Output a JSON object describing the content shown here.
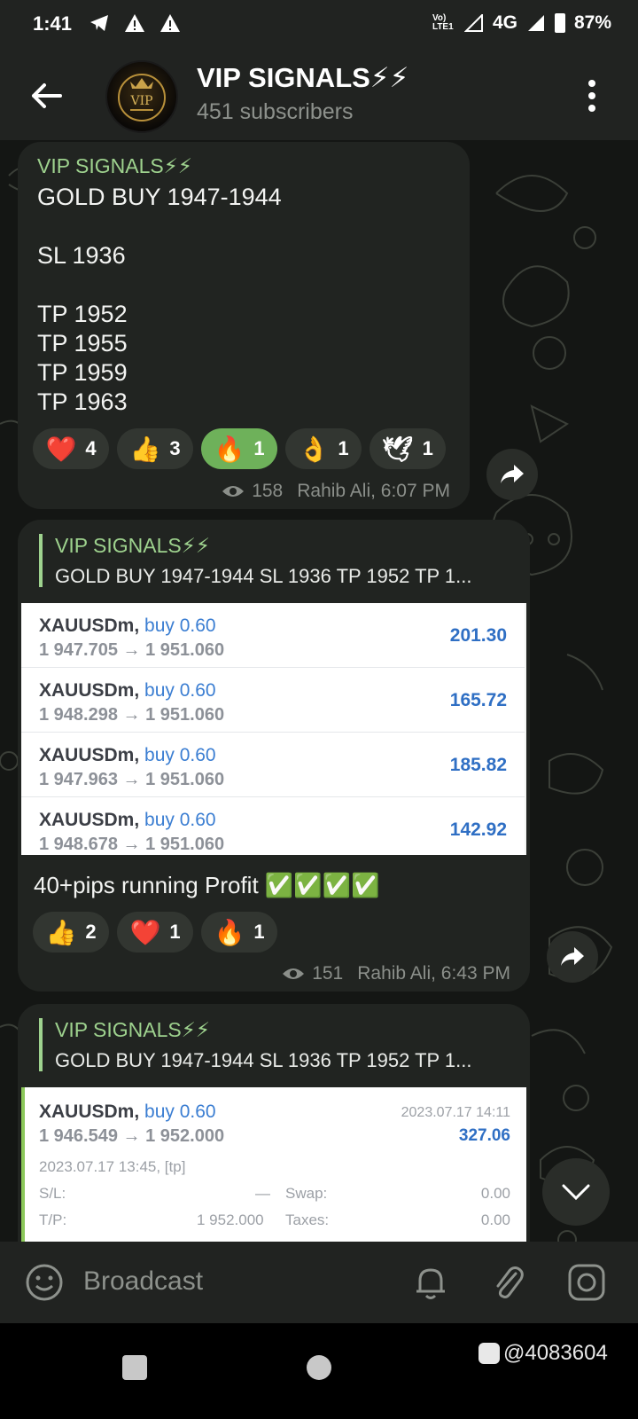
{
  "status_bar": {
    "time": "1:41",
    "left_icons": [
      "telegram-icon",
      "warning-icon",
      "warning-icon"
    ],
    "network": "4G",
    "volte": "Vo) LTE1",
    "battery": "87%"
  },
  "header": {
    "title": "VIP SIGNALS⚡⚡",
    "subtitle": "451 subscribers",
    "avatar_text": "VIP"
  },
  "messages": [
    {
      "sender": "VIP SIGNALS⚡⚡",
      "text": "GOLD BUY 1947-1944\n\nSL 1936\n\nTP 1952\nTP 1955\nTP 1959\nTP 1963",
      "reactions": [
        {
          "emoji": "❤️",
          "count": "4",
          "active": false
        },
        {
          "emoji": "👍",
          "count": "3",
          "active": false
        },
        {
          "emoji": "🔥",
          "count": "1",
          "active": true
        },
        {
          "emoji": "👌",
          "count": "1",
          "active": false
        },
        {
          "emoji": "🕊",
          "count": "1",
          "active": false
        }
      ],
      "views": "158",
      "author_time": "Rahib Ali, 6:07 PM"
    },
    {
      "reply_name": "VIP SIGNALS⚡⚡",
      "reply_text": "GOLD BUY 1947-1944  SL 1936  TP 1952 TP 1...",
      "trades": [
        {
          "symbol": "XAUUSDm,",
          "side": "buy 0.60",
          "prices": "1 947.705 → 1 951.060",
          "profit": "201.30"
        },
        {
          "symbol": "XAUUSDm,",
          "side": "buy 0.60",
          "prices": "1 948.298 → 1 951.060",
          "profit": "165.72"
        },
        {
          "symbol": "XAUUSDm,",
          "side": "buy 0.60",
          "prices": "1 947.963 → 1 951.060",
          "profit": "185.82"
        },
        {
          "symbol": "XAUUSDm,",
          "side": "buy 0.60",
          "prices": "1 948.678 → 1 951.060",
          "profit": "142.92"
        }
      ],
      "caption": "40+pips running Profit ✅✅✅✅",
      "reactions": [
        {
          "emoji": "👍",
          "count": "2"
        },
        {
          "emoji": "❤️",
          "count": "1"
        },
        {
          "emoji": "🔥",
          "count": "1"
        }
      ],
      "views": "151",
      "author_time": "Rahib Ali, 6:43 PM"
    },
    {
      "reply_name": "VIP SIGNALS⚡⚡",
      "reply_text": "GOLD BUY 1947-1944  SL 1936  TP 1952 TP 1...",
      "detail": {
        "symbol": "XAUUSDm,",
        "side": "buy 0.60",
        "prices": "1 946.549 → 1 952.000",
        "close_time": "2023.07.17 14:11",
        "profit": "327.06",
        "open_time": "2023.07.17 13:45, [tp]",
        "sl_label": "S/L:",
        "sl_value": "—",
        "tp_label": "T/P:",
        "tp_value": "1 952.000",
        "swap_label": "Swap:",
        "swap_value": "0.00",
        "taxes_label": "Taxes:",
        "taxes_value": "0.00"
      }
    }
  ],
  "composer": {
    "placeholder": "Broadcast"
  },
  "watermark": "@4083604",
  "colors": {
    "accent_green": "#9ed28e",
    "active_reaction": "#6eb15a",
    "profit_blue": "#2f6fc4"
  }
}
